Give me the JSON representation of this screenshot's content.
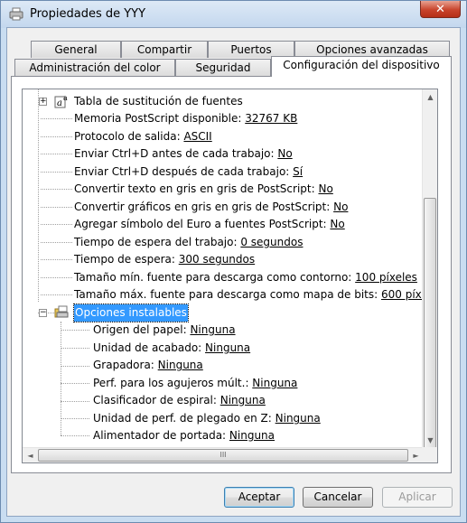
{
  "window": {
    "title": "Propiedades de YYY",
    "close_glyph": "✕"
  },
  "tabs_row1": [
    {
      "label": "General"
    },
    {
      "label": "Compartir"
    },
    {
      "label": "Puertos"
    },
    {
      "label": "Opciones avanzadas"
    }
  ],
  "tabs_row2": [
    {
      "label": "Administración del color"
    },
    {
      "label": "Seguridad"
    },
    {
      "label": "Configuración del dispositivo",
      "active": true
    }
  ],
  "tree": {
    "font_substitution": {
      "label": "Tabla de sustitución de fuentes"
    },
    "settings": [
      {
        "label": "Memoria PostScript disponible: ",
        "value": "32767 KB"
      },
      {
        "label": "Protocolo de salida: ",
        "value": "ASCII"
      },
      {
        "label": "Enviar Ctrl+D antes de cada trabajo: ",
        "value": "No"
      },
      {
        "label": "Enviar Ctrl+D después de cada trabajo: ",
        "value": "Sí"
      },
      {
        "label": "Convertir texto en gris en gris de PostScript: ",
        "value": "No"
      },
      {
        "label": "Convertir gráficos en gris en gris de PostScript: ",
        "value": "No"
      },
      {
        "label": "Agregar símbolo del Euro a fuentes PostScript: ",
        "value": "No"
      },
      {
        "label": "Tiempo de espera del trabajo: ",
        "value": "0 segundos"
      },
      {
        "label": "Tiempo de espera: ",
        "value": "300 segundos"
      },
      {
        "label": "Tamaño mín. fuente para descarga como contorno: ",
        "value": "100 píxeles"
      },
      {
        "label": "Tamaño máx. fuente para descarga como mapa de bits: ",
        "value": "600 píxeles"
      }
    ],
    "installable": {
      "label": "Opciones instalables",
      "children": [
        {
          "label": "Origen del papel: ",
          "value": "Ninguna"
        },
        {
          "label": "Unidad de acabado: ",
          "value": "Ninguna"
        },
        {
          "label": "Grapadora: ",
          "value": "Ninguna"
        },
        {
          "label": "Perf. para los agujeros múlt.: ",
          "value": "Ninguna"
        },
        {
          "label": "Clasificador de espiral: ",
          "value": "Ninguna"
        },
        {
          "label": "Unidad de perf. de plegado en Z: ",
          "value": "Ninguna"
        },
        {
          "label": "Alimentador de portada: ",
          "value": "Ninguna"
        }
      ]
    },
    "expand_glyph": "+",
    "collapse_glyph": "−"
  },
  "scroll": {
    "up": "▲",
    "down": "▼",
    "left": "◄",
    "right": "►",
    "grip": "III"
  },
  "buttons": {
    "ok": "Aceptar",
    "cancel": "Cancelar",
    "apply": "Aplicar"
  }
}
